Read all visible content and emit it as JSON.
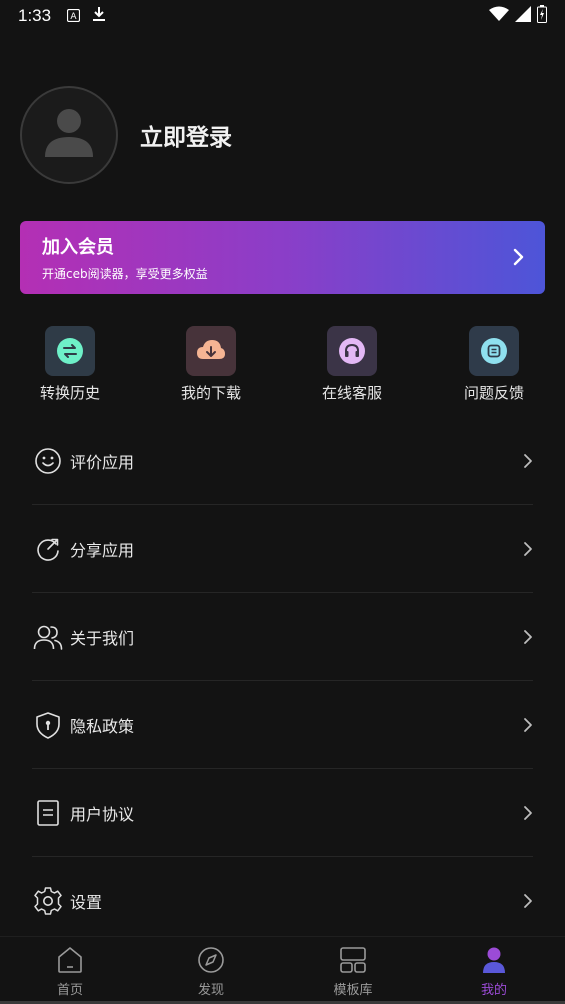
{
  "status_bar": {
    "time": "1:33",
    "icons": [
      "text-a-icon",
      "download-icon",
      "wifi-icon",
      "signal-icon",
      "battery-charging-icon"
    ]
  },
  "profile": {
    "login_text": "立即登录",
    "avatar_icon": "user-placeholder-icon"
  },
  "vip_banner": {
    "title": "加入会员",
    "subtitle": "开通ceb阅读器，享受更多权益",
    "gradient_start": "#b42fb4",
    "gradient_end": "#4d55d8"
  },
  "quick_actions": [
    {
      "label": "转换历史",
      "icon": "convert-history-icon",
      "bg": "#2f3b47",
      "fg": "#6ef0c8"
    },
    {
      "label": "我的下载",
      "icon": "cloud-download-icon",
      "bg": "#47333a",
      "fg": "#f5b493"
    },
    {
      "label": "在线客服",
      "icon": "headset-icon",
      "bg": "#3b3447",
      "fg": "#e3b8f5"
    },
    {
      "label": "问题反馈",
      "icon": "feedback-icon",
      "bg": "#2f3b4a",
      "fg": "#8fe0ef"
    }
  ],
  "menu": [
    {
      "label": "评价应用",
      "icon": "smile-icon"
    },
    {
      "label": "分享应用",
      "icon": "share-icon"
    },
    {
      "label": "关于我们",
      "icon": "users-icon"
    },
    {
      "label": "隐私政策",
      "icon": "shield-icon"
    },
    {
      "label": "用户协议",
      "icon": "document-icon"
    },
    {
      "label": "设置",
      "icon": "gear-icon"
    }
  ],
  "bottom_nav": [
    {
      "label": "首页",
      "icon": "home-icon",
      "active": false
    },
    {
      "label": "发现",
      "icon": "compass-icon",
      "active": false
    },
    {
      "label": "模板库",
      "icon": "template-icon",
      "active": false
    },
    {
      "label": "我的",
      "icon": "profile-icon",
      "active": true
    }
  ],
  "colors": {
    "background": "#131313",
    "accent": "#9b4bd6"
  }
}
